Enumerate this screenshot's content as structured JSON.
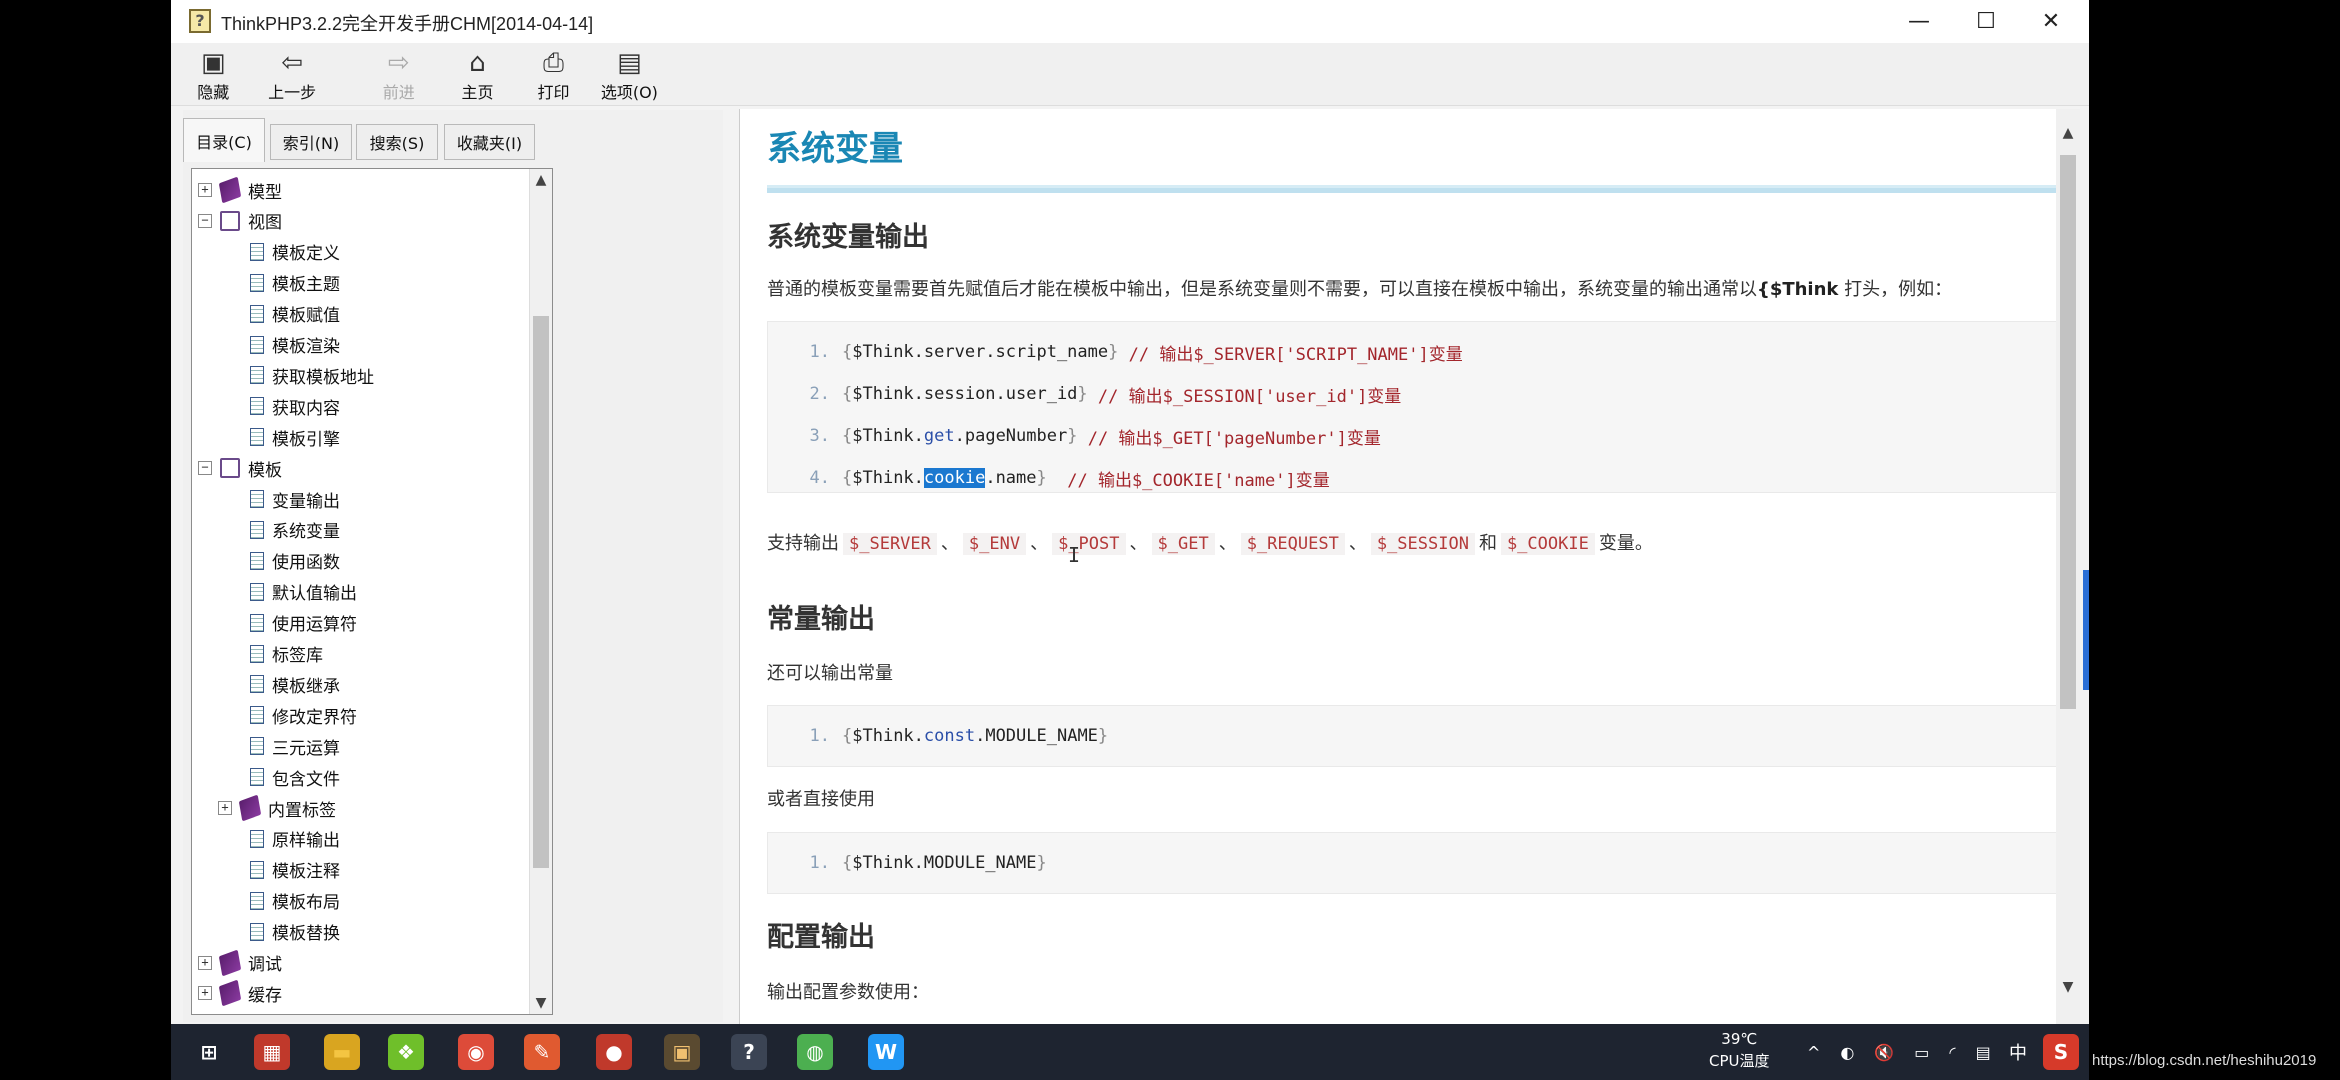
{
  "window": {
    "title": "ThinkPHP3.2.2完全开发手册CHM[2014-04-14]",
    "controls": {
      "minimize": "—",
      "maximize": "☐",
      "close": "✕"
    }
  },
  "toolbar": {
    "items": [
      {
        "label": "隐藏",
        "icon": "hide-icon",
        "glyph": "▣",
        "enabled": true
      },
      {
        "label": "上一步",
        "icon": "back-arrow-icon",
        "glyph": "⇦",
        "enabled": true
      },
      {
        "label": "前进",
        "icon": "forward-arrow-icon",
        "glyph": "⇨",
        "enabled": false
      },
      {
        "label": "主页",
        "icon": "home-icon",
        "glyph": "⌂",
        "enabled": true
      },
      {
        "label": "打印",
        "icon": "printer-icon",
        "glyph": "⎙",
        "enabled": true
      },
      {
        "label": "选项(O)",
        "icon": "options-icon",
        "glyph": "▤",
        "enabled": true
      }
    ]
  },
  "nav_tabs": [
    "目录(C)",
    "索引(N)",
    "搜索(S)",
    "收藏夹(I)"
  ],
  "tree": [
    {
      "label": "模型",
      "type": "book-closed",
      "expander": "+",
      "indent": 0
    },
    {
      "label": "视图",
      "type": "book-open",
      "expander": "−",
      "indent": 0
    },
    {
      "label": "模板定义",
      "type": "page",
      "indent": 1
    },
    {
      "label": "模板主题",
      "type": "page",
      "indent": 1
    },
    {
      "label": "模板赋值",
      "type": "page",
      "indent": 1
    },
    {
      "label": "模板渲染",
      "type": "page",
      "indent": 1
    },
    {
      "label": "获取模板地址",
      "type": "page",
      "indent": 1
    },
    {
      "label": "获取内容",
      "type": "page",
      "indent": 1
    },
    {
      "label": "模板引擎",
      "type": "page",
      "indent": 1
    },
    {
      "label": "模板",
      "type": "book-open",
      "expander": "−",
      "indent": 0
    },
    {
      "label": "变量输出",
      "type": "page",
      "indent": 1
    },
    {
      "label": "系统变量",
      "type": "page",
      "indent": 1
    },
    {
      "label": "使用函数",
      "type": "page",
      "indent": 1
    },
    {
      "label": "默认值输出",
      "type": "page",
      "indent": 1
    },
    {
      "label": "使用运算符",
      "type": "page",
      "indent": 1
    },
    {
      "label": "标签库",
      "type": "page",
      "indent": 1
    },
    {
      "label": "模板继承",
      "type": "page",
      "indent": 1
    },
    {
      "label": "修改定界符",
      "type": "page",
      "indent": 1
    },
    {
      "label": "三元运算",
      "type": "page",
      "indent": 1
    },
    {
      "label": "包含文件",
      "type": "page",
      "indent": 1
    },
    {
      "label": "内置标签",
      "type": "book-closed",
      "expander": "+",
      "indent": 1
    },
    {
      "label": "原样输出",
      "type": "page",
      "indent": 1
    },
    {
      "label": "模板注释",
      "type": "page",
      "indent": 1
    },
    {
      "label": "模板布局",
      "type": "page",
      "indent": 1
    },
    {
      "label": "模板替换",
      "type": "page",
      "indent": 1
    },
    {
      "label": "调试",
      "type": "book-closed",
      "expander": "+",
      "indent": 0
    },
    {
      "label": "缓存",
      "type": "book-closed",
      "expander": "+",
      "indent": 0
    }
  ],
  "content": {
    "title": "系统变量",
    "nav_prev": "←",
    "nav_next": "→",
    "s1_title": "系统变量输出",
    "s1_intro_a": "普通的模板变量需要首先赋值后才能在模板中输出，但是系统变量则不需要，可以直接在模板中输出，系统变量的输出通常以",
    "s1_intro_b": "{$Think",
    "s1_intro_c": " 打头，例如：",
    "code1": [
      {
        "n": "1.",
        "parts": [
          [
            "br",
            "{"
          ],
          [
            "tx",
            "$Think.server.script_name"
          ],
          [
            "br",
            "}"
          ],
          [
            "cm",
            " // 输出$_SERVER['SCRIPT_NAME']变量"
          ]
        ]
      },
      {
        "n": "2.",
        "parts": [
          [
            "br",
            "{"
          ],
          [
            "tx",
            "$Think.session.user_id"
          ],
          [
            "br",
            "}"
          ],
          [
            "cm",
            " // 输出$_SESSION['user_id']变量"
          ]
        ]
      },
      {
        "n": "3.",
        "parts": [
          [
            "br",
            "{"
          ],
          [
            "tx",
            "$Think."
          ],
          [
            "kw",
            "get"
          ],
          [
            "tx",
            ".pageNumber"
          ],
          [
            "br",
            "}"
          ],
          [
            "cm",
            " // 输出$_GET['pageNumber']变量"
          ]
        ]
      },
      {
        "n": "4.",
        "parts": [
          [
            "br",
            "{"
          ],
          [
            "tx",
            "$Think."
          ],
          [
            "sel",
            "cookie"
          ],
          [
            "tx",
            ".name"
          ],
          [
            "br",
            "}"
          ],
          [
            "cm",
            "  // 输出$_COOKIE['name']变量"
          ]
        ]
      }
    ],
    "support_lead": "支持输出",
    "support_items": [
      "$_SERVER",
      "$_ENV",
      "$_POST",
      "$_GET",
      "$_REQUEST",
      "$_SESSION",
      "$_COOKIE"
    ],
    "support_seps": [
      "、",
      "、",
      "、",
      "、",
      "、",
      "和"
    ],
    "support_tail": "变量。",
    "s2_title": "常量输出",
    "s2_intro": "还可以输出常量",
    "code2": [
      {
        "n": "1.",
        "parts": [
          [
            "br",
            "{"
          ],
          [
            "tx",
            "$Think."
          ],
          [
            "kw",
            "const"
          ],
          [
            "tx",
            ".MODULE_NAME"
          ],
          [
            "br",
            "}"
          ]
        ]
      }
    ],
    "s2_or": "或者直接使用",
    "code3": [
      {
        "n": "1.",
        "parts": [
          [
            "br",
            "{"
          ],
          [
            "tx",
            "$Think.MODULE_NAME"
          ],
          [
            "br",
            "}"
          ]
        ]
      }
    ],
    "s3_title": "配置输出",
    "s3_intro": "输出配置参数使用："
  },
  "taskbar": {
    "apps": [
      {
        "name": "windows-start-icon",
        "glyph": "⊞",
        "color": "#ffffff",
        "bg": "transparent"
      },
      {
        "name": "task-view-icon",
        "glyph": "▦",
        "color": "#ffffff",
        "bg": "#c0392b"
      },
      {
        "name": "file-explorer-icon",
        "glyph": "▬",
        "color": "#f4c542",
        "bg": "#d9a520"
      },
      {
        "name": "green-app-icon",
        "glyph": "❖",
        "color": "#ffffff",
        "bg": "#6fbf2a"
      },
      {
        "name": "chrome-icon",
        "glyph": "◉",
        "color": "#ffffff",
        "bg": "#dd4b39"
      },
      {
        "name": "editor-app-icon",
        "glyph": "✎",
        "color": "#ffffff",
        "bg": "#e05a30"
      },
      {
        "name": "video-app-icon",
        "glyph": "●",
        "color": "#ffffff",
        "bg": "#c0392b"
      },
      {
        "name": "terminal-app-icon",
        "glyph": "▣",
        "color": "#f0c070",
        "bg": "#5a4a30"
      },
      {
        "name": "chm-help-icon",
        "glyph": "?",
        "color": "#ffffff",
        "bg": "#3b4454"
      },
      {
        "name": "green-circle-app-icon",
        "glyph": "◍",
        "color": "#ffffff",
        "bg": "#4caf50"
      },
      {
        "name": "blue-app-icon",
        "glyph": "W",
        "color": "#ffffff",
        "bg": "#2196f3"
      }
    ],
    "cpu_temp": "39℃",
    "cpu_label": "CPU温度",
    "ime": "中",
    "tray_icons": [
      "^",
      "◐",
      "🔇",
      "▭",
      "◜",
      "▤"
    ]
  },
  "watermark": "https://blog.csdn.net/heshihu2019"
}
